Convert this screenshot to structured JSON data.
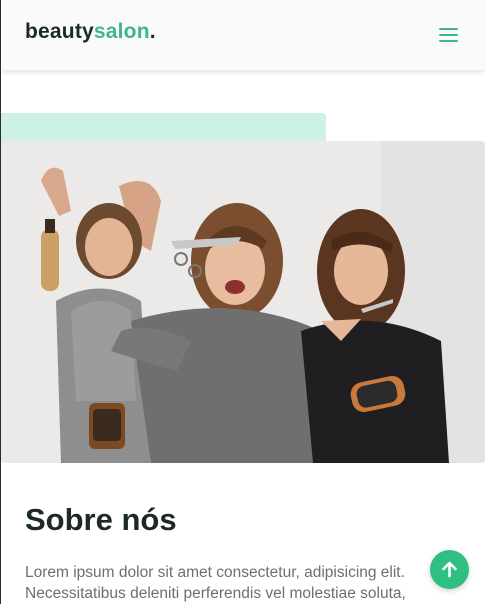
{
  "header": {
    "logo_main": "beauty",
    "logo_accent": "salon",
    "logo_dot": ".",
    "menu_icon": "hamburger-menu-icon"
  },
  "colors": {
    "accent": "#3fb68b",
    "mint": "#cdf1e2",
    "button": "#2fbf82",
    "heading": "#1b2a22",
    "body_text": "#6b6f72"
  },
  "about": {
    "title": "Sobre nós",
    "paragraph_line1": "Lorem ipsum dolor sit amet consectetur, adipisicing elit.",
    "paragraph_line2": "Necessitatibus deleniti perferendis vel molestiae soluta,"
  },
  "back_to_top": {
    "icon": "arrow-up-icon"
  }
}
